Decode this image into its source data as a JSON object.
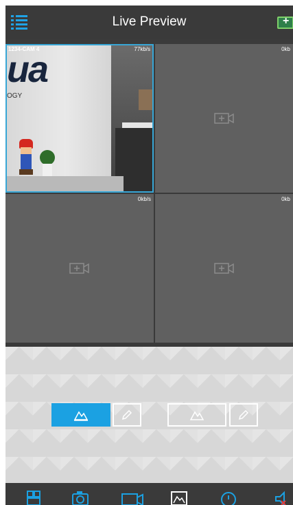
{
  "header": {
    "title": "Live Preview",
    "menu_icon": "list-menu-icon",
    "add_icon": "add-device-icon"
  },
  "grid": {
    "cells": [
      {
        "camera_name": "1234-CAM 4",
        "bitrate": "77kb/s",
        "timestamp": "",
        "has_video": true
      },
      {
        "bitrate": "0kb",
        "icon": "add-camera-icon",
        "has_video": false
      },
      {
        "bitrate": "0kb/s",
        "icon": "add-camera-icon",
        "has_video": false
      },
      {
        "bitrate": "0kb",
        "icon": "add-camera-icon",
        "has_video": false
      }
    ],
    "feed_text": {
      "logo": "ua",
      "sub": "OGY"
    }
  },
  "controls": [
    {
      "name": "image-adjust-button",
      "icon": "image-icon",
      "active": true
    },
    {
      "name": "edit-button-1",
      "icon": "pencil-icon",
      "active": false
    },
    {
      "name": "image-toggle-button",
      "icon": "mountain-icon",
      "active": false
    },
    {
      "name": "edit-button-2",
      "icon": "pencil-icon",
      "active": false
    }
  ],
  "toolbar": {
    "items": [
      "grid-layout-icon",
      "snapshot-camera-icon",
      "record-video-icon",
      "image-gallery-icon",
      "ptz-clock-icon",
      "mute-speaker-icon"
    ]
  },
  "colors": {
    "accent": "#1ba1e2",
    "header_bg": "#3a3a3a",
    "cell_bg": "#606060",
    "panel_bg": "#d7d7d7",
    "add_icon_green": "#7fd06a"
  }
}
